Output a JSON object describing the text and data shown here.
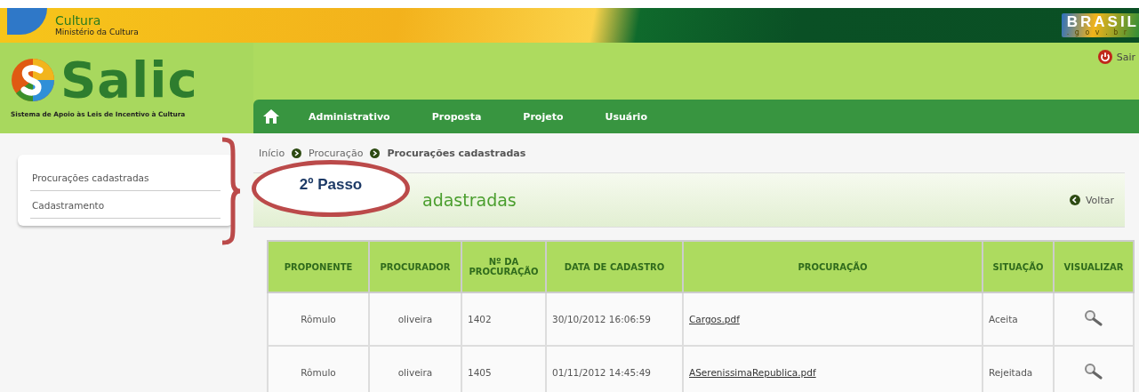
{
  "banner": {
    "title": "Cultura",
    "subtitle": "Ministério da Cultura",
    "gov_logo": {
      "word": "BRASIL",
      "domain": ". g o v . b r"
    }
  },
  "header": {
    "logo": "Salic",
    "tagline": "Sistema de Apoio às Leis de Incentivo à Cultura",
    "logout": "Sair"
  },
  "nav": {
    "items": [
      "Administrativo",
      "Proposta",
      "Projeto",
      "Usuário"
    ]
  },
  "sidebar": {
    "items": [
      {
        "label": "Procurações cadastradas"
      },
      {
        "label": "Cadastramento"
      }
    ]
  },
  "breadcrumb": [
    {
      "label": "Início",
      "current": false
    },
    {
      "label": "Procuração",
      "current": false
    },
    {
      "label": "Procurações cadastradas",
      "current": true
    }
  ],
  "annotation": {
    "label": "2º Passo"
  },
  "page_title": "adastradas",
  "back_link": "Voltar",
  "table": {
    "columns": [
      "PROPONENTE",
      "PROCURADOR",
      "Nº DA PROCURAÇÃO",
      "DATA DE CADASTRO",
      "PROCURAÇÃO",
      "SITUAÇÃO",
      "VISUALIZAR"
    ],
    "rows": [
      {
        "proponente": "Rômulo",
        "procurador": "oliveira",
        "numero": "1402",
        "data": "30/10/2012 16:06:59",
        "arquivo": "Cargos.pdf",
        "situacao": "Aceita"
      },
      {
        "proponente": "Rômulo",
        "procurador": "oliveira",
        "numero": "1405",
        "data": "01/11/2012 14:45:49",
        "arquivo": "ASerenissimaRepublica.pdf",
        "situacao": "Rejeitada"
      }
    ]
  }
}
